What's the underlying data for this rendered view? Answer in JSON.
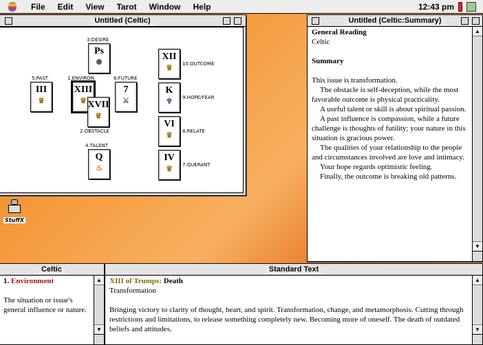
{
  "menubar": {
    "items": [
      "File",
      "Edit",
      "View",
      "Tarot",
      "Window",
      "Help"
    ],
    "clock": "12:43 pm"
  },
  "spread_window": {
    "title": "Untitled (Celtic)",
    "positions": {
      "desire": "3.DESIRE",
      "past": "5.PAST",
      "environ": "1.ENVIRON",
      "future": "6.FUTURE",
      "obstacle": "2.OBSTACLE",
      "talent": "4.TALENT",
      "outcome": "10.OUTCOME",
      "hopefear": "9.HOPE/FEAR",
      "relate": "8.RELATE",
      "querant": "7.QUERANT"
    },
    "cards": {
      "desire": "Ps",
      "past": "III",
      "environ": "XIII",
      "obstacle": "XVII",
      "future": "7",
      "talent": "Q",
      "outcome": "XII",
      "hopefear": "K",
      "relate": "VI",
      "querant": "IV"
    },
    "suit_glyphs": {
      "desire": "✺",
      "past": "♛",
      "environ": "♛",
      "obstacle": "♛",
      "future": "⚔",
      "talent": "♨",
      "outcome": "♛",
      "hopefear": "♆",
      "relate": "♛",
      "querant": "♛"
    }
  },
  "summary_window": {
    "title": "Untitled (Celtic:Summary)",
    "heading": "General Reading",
    "subheading": "Celtic",
    "section": "Summary",
    "paragraphs": [
      "This issue is transformation.",
      "The obstacle is self-deception, while the most favorable outcome is physical practicality.",
      "A useful talent or skill is about spiritual passion.",
      "A past influence is compassion, while a future challenge is thoughts of futility; your nature in this situation is gracious power.",
      "The qualities of your relationship to the people and circumstances involved are love and intimacy.",
      "Your hope regards optimistic feeling.",
      "Finally, the outcome is breaking old patterns."
    ]
  },
  "celtic_window": {
    "title": "Celtic",
    "number": "1.",
    "position": "Environment",
    "text": "The situation or issue's general influence or nature."
  },
  "standard_window": {
    "title": "Standard Text",
    "card_name": "XIII of Trumps:",
    "card_title": "Death",
    "keyword": "Transformation",
    "body": "Bringing victory to clarity of thought, heart, and spirit. Transformation, change, and metamorphosis. Cutting through restrictions and limitations, to release something completely new. Becoming more of oneself. The death of outdated beliefs and attitudes."
  },
  "desktop": {
    "icon_label": "StuffX"
  }
}
